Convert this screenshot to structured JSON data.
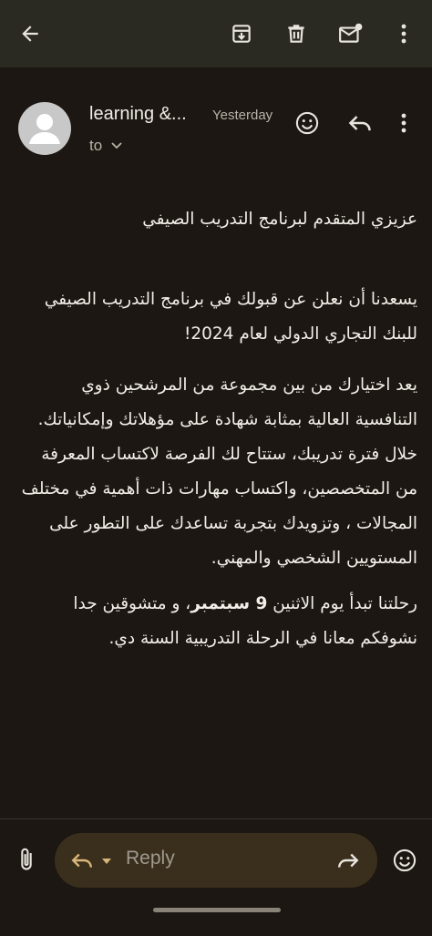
{
  "toolbar": {
    "icons": [
      "back-icon",
      "archive-icon",
      "delete-icon",
      "mark-unread-icon",
      "more-icon"
    ]
  },
  "message": {
    "sender_name": "learning &...",
    "time": "Yesterday",
    "to_label": "to",
    "greeting": "عزيزي المتقدم لبرنامج التدريب الصيفي",
    "paragraph1": "يسعدنا أن نعلن عن قبولك في برنامج التدريب الصيفي للبنك التجاري الدولي لعام 2024!",
    "paragraph2": "يعد اختيارك من بين مجموعة من المرشحين ذوي التنافسية العالية بمثابة شهادة على مؤهلاتك وإمكانياتك. خلال فترة تدريبك، ستتاح لك الفرصة لاكتساب المعرفة من المتخصصين، واكتساب  مهارات ذات أهمية في مختلف المجالات ،  وتزويدك بتجربة تساعدك على التطور على المستويين الشخصي والمهني.",
    "paragraph3_start": "رحلتنا تبدأ يوم الاثنين ",
    "paragraph3_bold": "9 سبتمبر",
    "paragraph3_end": "، و متشوقين جدا نشوفكم معانا في الرحلة التدريبية السنة دي."
  },
  "bottom_bar": {
    "reply_label": "Reply"
  },
  "colors": {
    "background": "#1c1712",
    "topbar": "#2a2a22",
    "reply_pill": "#3a2f1c",
    "accent": "#d9b77a"
  }
}
